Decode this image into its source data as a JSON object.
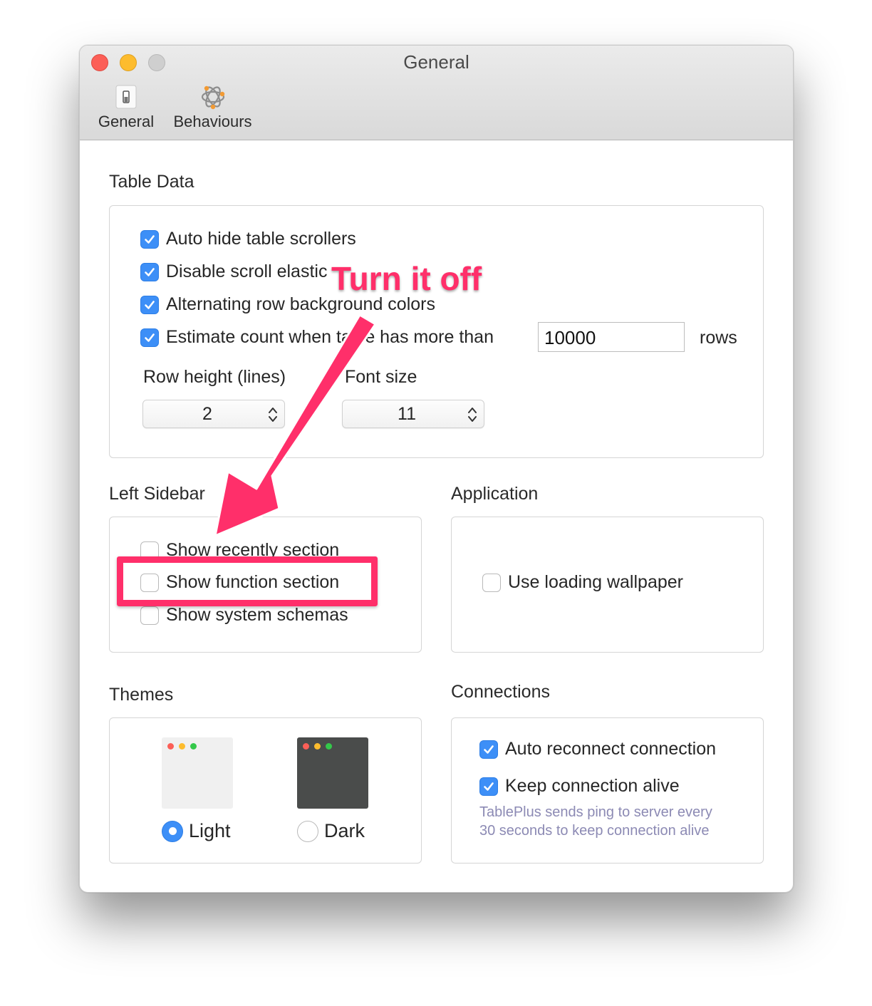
{
  "window": {
    "title": "General"
  },
  "toolbar": {
    "items": [
      {
        "label": "General",
        "icon": "switch-icon"
      },
      {
        "label": "Behaviours",
        "icon": "molecule-icon"
      }
    ]
  },
  "table_data": {
    "title": "Table Data",
    "options": [
      {
        "label": "Auto hide table scrollers",
        "checked": true
      },
      {
        "label": "Disable scroll elastic",
        "checked": true
      },
      {
        "label": "Alternating row background colors",
        "checked": true
      },
      {
        "label": "Estimate count when table has more than",
        "checked": true
      }
    ],
    "estimate_value": "10000",
    "estimate_unit": "rows",
    "row_height_label": "Row height (lines)",
    "row_height_value": "2",
    "font_size_label": "Font size",
    "font_size_value": "11"
  },
  "left_sidebar": {
    "title": "Left Sidebar",
    "options": [
      {
        "label": "Show recently section",
        "checked": false
      },
      {
        "label": "Show function section",
        "checked": false
      },
      {
        "label": "Show system schemas",
        "checked": false
      }
    ]
  },
  "application": {
    "title": "Application",
    "options": [
      {
        "label": "Use loading wallpaper",
        "checked": false
      }
    ]
  },
  "themes": {
    "title": "Themes",
    "options": [
      {
        "label": "Light",
        "selected": true
      },
      {
        "label": "Dark",
        "selected": false
      }
    ]
  },
  "connections": {
    "title": "Connections",
    "options": [
      {
        "label": "Auto reconnect connection",
        "checked": true
      },
      {
        "label": "Keep connection alive",
        "checked": true
      }
    ],
    "note_line1": "TablePlus sends ping to server every",
    "note_line2": "30 seconds to keep connection alive"
  },
  "annotation": {
    "text": "Turn it off",
    "color": "#ff2f6a"
  },
  "colors": {
    "accent": "#3d8ff7",
    "note": "#8c8ab4"
  }
}
